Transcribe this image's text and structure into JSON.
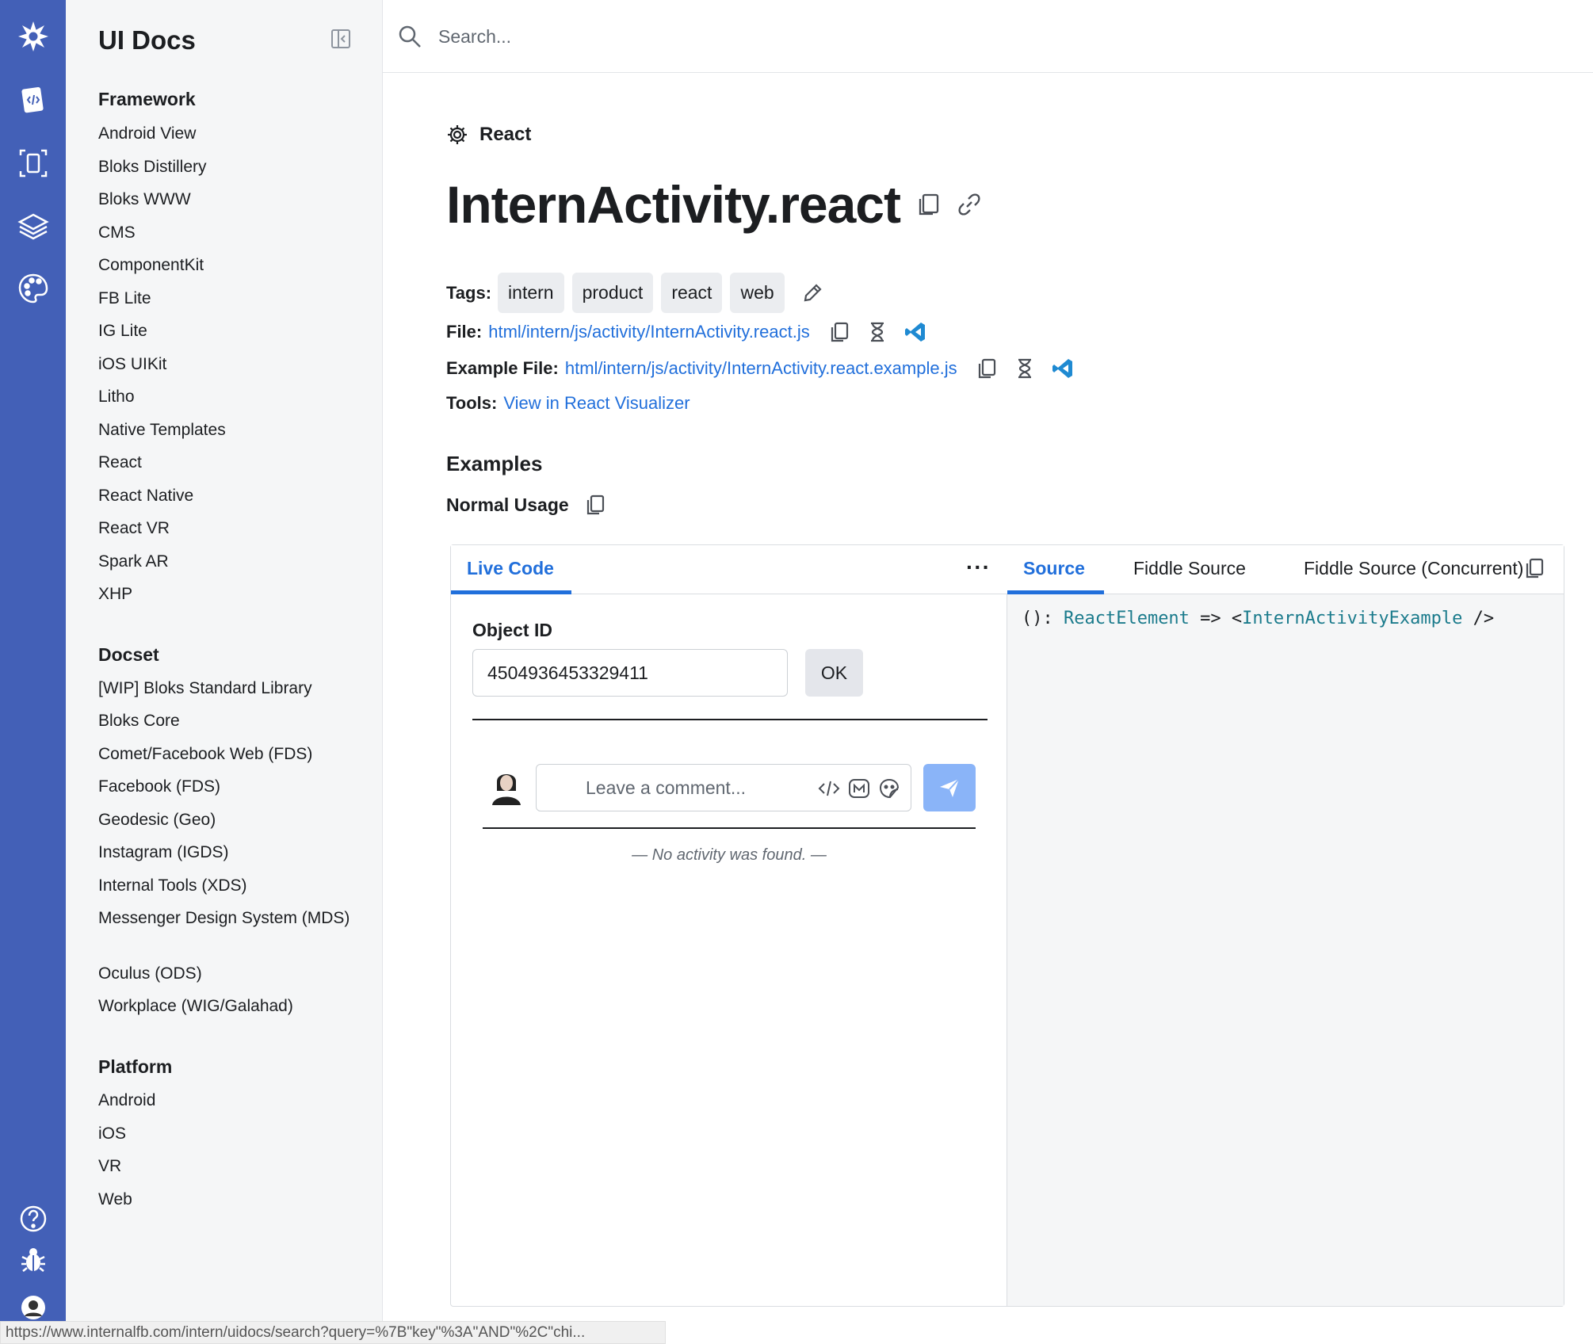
{
  "sidebar": {
    "title": "UI Docs",
    "sections": [
      {
        "heading": "Framework",
        "items": [
          "Android View",
          "Bloks Distillery",
          "Bloks WWW",
          "CMS",
          "ComponentKit",
          "FB Lite",
          "IG Lite",
          "iOS UIKit",
          "Litho",
          "Native Templates",
          "React",
          "React Native",
          "React VR",
          "Spark AR",
          "XHP"
        ]
      },
      {
        "heading": "Docset",
        "items": [
          "[WIP] Bloks Standard Library",
          "Bloks Core",
          "Comet/Facebook Web (FDS)",
          "Facebook (FDS)",
          "Geodesic (Geo)",
          "Instagram (IGDS)",
          "Internal Tools (XDS)",
          "Messenger Design System (MDS)",
          "Oculus (ODS)",
          "Workplace (WIG/Galahad)"
        ]
      },
      {
        "heading": "Platform",
        "items": [
          "Android",
          "iOS",
          "VR",
          "Web"
        ]
      }
    ]
  },
  "search": {
    "placeholder": "Search..."
  },
  "page": {
    "crumb": "React",
    "title": "InternActivity.react",
    "tags_label": "Tags:",
    "tags": [
      "intern",
      "product",
      "react",
      "web"
    ],
    "file_label": "File:",
    "file_link": "html/intern/js/activity/InternActivity.react.js",
    "example_file_label": "Example File:",
    "example_file_link": "html/intern/js/activity/InternActivity.react.example.js",
    "tools_label": "Tools:",
    "tools_link": "View in React Visualizer",
    "examples_heading": "Examples",
    "example_name": "Normal Usage"
  },
  "panel": {
    "left_tab": "Live Code",
    "more": "···",
    "right_tabs": [
      "Source",
      "Fiddle Source",
      "Fiddle Source (Concurrent)"
    ],
    "field_label": "Object ID",
    "object_id": "4504936453329411",
    "ok_label": "OK",
    "comment_placeholder": "Leave a comment...",
    "no_activity": "— No activity was found. —",
    "code": {
      "prefix": "(): ",
      "type1": "ReactElement",
      "mid": " => <",
      "type2": "InternActivityExample",
      "suffix": " />"
    }
  },
  "status_url": "https://www.internalfb.com/intern/uidocs/search?query=%7B\"key\"%3A\"AND\"%2C\"chi...",
  "colors": {
    "rail": "#4360b7",
    "link": "#216fdb",
    "send": "#8ab4f8"
  }
}
